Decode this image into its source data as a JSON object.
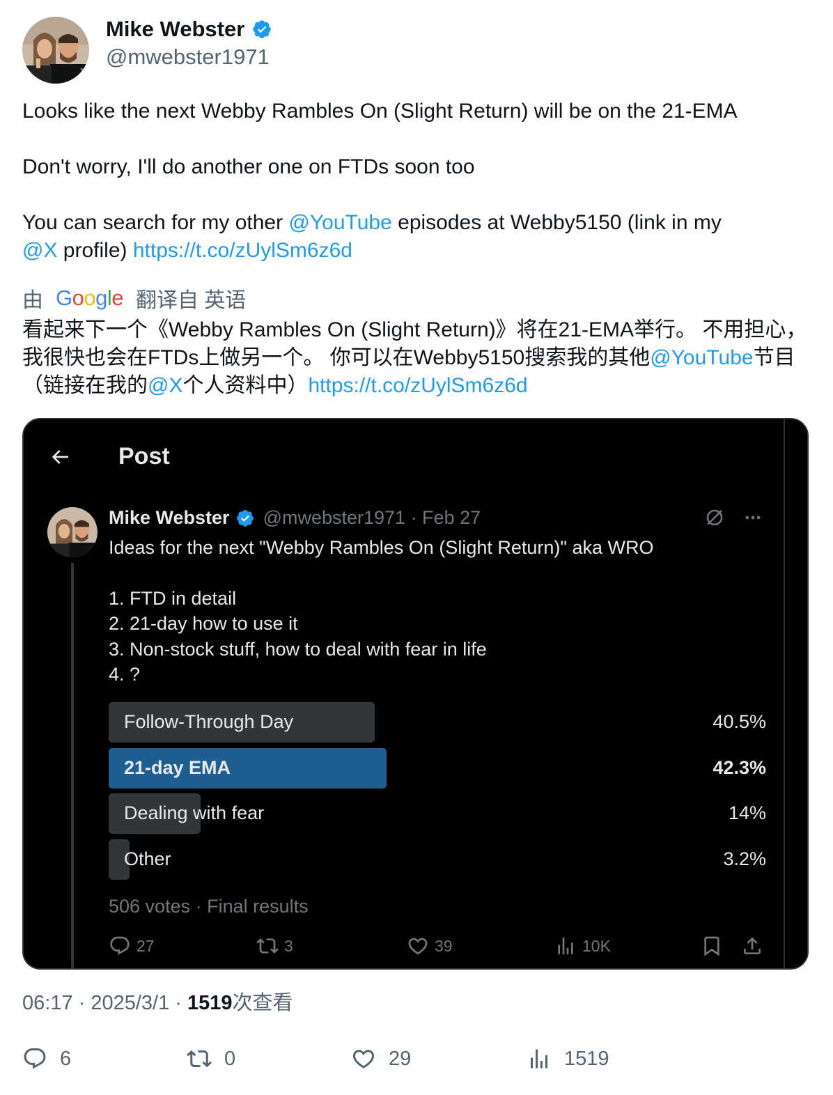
{
  "author": {
    "name": "Mike Webster",
    "handle": "@mwebster1971"
  },
  "tweet": {
    "line1": "Looks like the next Webby Rambles On (Slight Return) will be on the 21-EMA",
    "line2": "Don't worry, I'll do another one on FTDs soon too",
    "line3_pre": "You can search for my other ",
    "mention_youtube": "@YouTube",
    "line3_mid": " episodes at Webby5150 (link in my",
    "mention_x": "@X",
    "line4_mid": " profile) ",
    "url": "https://t.co/zUylSm6z6d"
  },
  "translation": {
    "by": "由",
    "google": "Google",
    "from": "翻译自 英语",
    "part1": "看起来下一个《Webby Rambles On (Slight Return)》将在21-EMA举行。 不用担心，我很快也会在FTDs上做另一个。 你可以在Webby5150搜索我的其他",
    "mention_youtube": "@YouTube",
    "part2": "节目（链接在我的",
    "mention_x": "@X",
    "part3": "个人资料中）",
    "url": "https://t.co/zUylSm6z6d"
  },
  "embed": {
    "header_title": "Post",
    "author_name": "Mike Webster",
    "author_handle_date": "@mwebster1971 · Feb 27",
    "text_line1": "Ideas for the next \"Webby Rambles On (Slight Return)\" aka WRO",
    "list": [
      "1. FTD in detail",
      "2. 21-day how to use it",
      "3. Non-stock stuff, how to deal with fear in life",
      "4. ?"
    ],
    "poll": [
      {
        "label": "Follow-Through Day",
        "pct": "40.5%",
        "share": 0.405,
        "winner": false
      },
      {
        "label": "21-day EMA",
        "pct": "42.3%",
        "share": 0.423,
        "winner": true
      },
      {
        "label": "Dealing with fear",
        "pct": "14%",
        "share": 0.14,
        "winner": false
      },
      {
        "label": "Other",
        "pct": "3.2%",
        "share": 0.032,
        "winner": false
      }
    ],
    "poll_meta": "506 votes · Final results",
    "stats": {
      "replies": "27",
      "reposts": "3",
      "likes": "39",
      "views": "10K"
    }
  },
  "meta": {
    "time_date": "06:17 · 2025/3/1 · ",
    "views_count": "1519",
    "views_label": "次查看"
  },
  "stats": {
    "replies": "6",
    "reposts": "0",
    "likes": "29",
    "views": "1519"
  },
  "colors": {
    "link": "#1d9bf0",
    "verified": "#1d9bf0",
    "poll_winner": "#1d5f91",
    "poll_other": "#333639"
  }
}
